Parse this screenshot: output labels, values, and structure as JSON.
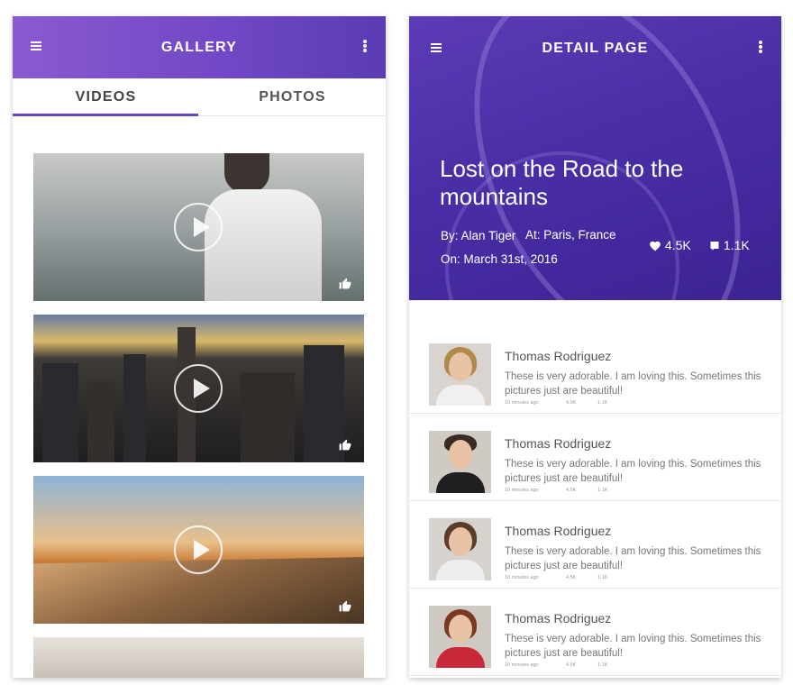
{
  "gallery": {
    "title": "GALLERY",
    "tabs": [
      {
        "label": "VIDEOS",
        "active": true
      },
      {
        "label": "PHOTOS",
        "active": false
      }
    ],
    "videos": [
      {
        "name": "man-in-white-shirt"
      },
      {
        "name": "city-skyline-sunset"
      },
      {
        "name": "beach-sunset"
      },
      {
        "name": "cat-closeup"
      }
    ],
    "accent": "#6a45c2"
  },
  "detail": {
    "title": "DETAIL PAGE",
    "headline": "Lost on the Road to the mountains",
    "by": "By: Alan Tiger",
    "at": "At: Paris, France",
    "on": "On: March 31st, 2016",
    "likes": "4.5K",
    "comments": "1.1K",
    "hero_color": "#4a2ea6",
    "comment_list": [
      {
        "name": "Thomas Rodriguez",
        "text": "These is very adorable. I am loving this. Sometimes this pictures just are beautiful!",
        "time": "10 minutes ago",
        "likes": "4.5K",
        "replies": "1.1K"
      },
      {
        "name": "Thomas Rodriguez",
        "text": "These is very adorable. I am loving this. Sometimes this pictures just are beautiful!",
        "time": "10 minutes ago",
        "likes": "4.5K",
        "replies": "1.1K"
      },
      {
        "name": "Thomas Rodriguez",
        "text": "These is very adorable. I am loving this. Sometimes this pictures just are beautiful!",
        "time": "10 minutes ago",
        "likes": "4.5K",
        "replies": "1.1K"
      },
      {
        "name": "Thomas Rodriguez",
        "text": "These is very adorable. I am loving this. Sometimes this pictures just are beautiful!",
        "time": "10 minutes ago",
        "likes": "4.5K",
        "replies": "1.1K"
      }
    ]
  }
}
